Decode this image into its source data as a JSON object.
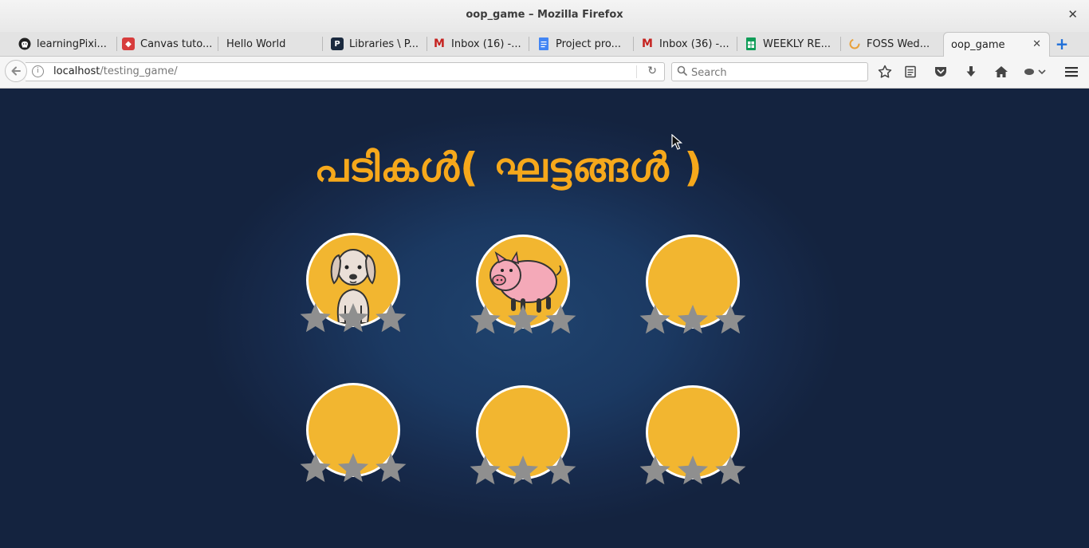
{
  "window": {
    "title": "oop_game – Mozilla Firefox"
  },
  "tabs": [
    {
      "label": "learningPixi...",
      "icon": "github-icon"
    },
    {
      "label": "Canvas tuto...",
      "icon": "mdn-dino-icon"
    },
    {
      "label": "Hello World",
      "icon": ""
    },
    {
      "label": "Libraries \\ P...",
      "icon": "pixi-icon"
    },
    {
      "label": "Inbox (16) -...",
      "icon": "gmail-icon"
    },
    {
      "label": "Project pro...",
      "icon": "google-docs-icon"
    },
    {
      "label": "Inbox (36) -...",
      "icon": "gmail-icon"
    },
    {
      "label": "WEEKLY RE...",
      "icon": "google-sheets-icon"
    },
    {
      "label": "FOSS Wed...",
      "icon": "loading-icon"
    },
    {
      "label": "oop_game",
      "icon": "",
      "active": true
    }
  ],
  "navbar": {
    "url_host": "localhost",
    "url_path": "/testing_game/",
    "search_placeholder": "Search"
  },
  "game": {
    "title": "പടികൾ( ഘട്ടങ്ങൾ )",
    "levels": [
      {
        "image": "dog-icon",
        "stars": 3,
        "stars_earned": 0
      },
      {
        "image": "pig-icon",
        "stars": 3,
        "stars_earned": 0
      },
      {
        "image": "",
        "stars": 3,
        "stars_earned": 0
      },
      {
        "image": "",
        "stars": 3,
        "stars_earned": 0
      },
      {
        "image": "",
        "stars": 3,
        "stars_earned": 0
      },
      {
        "image": "",
        "stars": 3,
        "stars_earned": 0
      }
    ],
    "colors": {
      "medal": "#f2b630",
      "star_empty": "#8f8f8f",
      "title": "#f6a81b",
      "background": "#172b4d"
    }
  }
}
